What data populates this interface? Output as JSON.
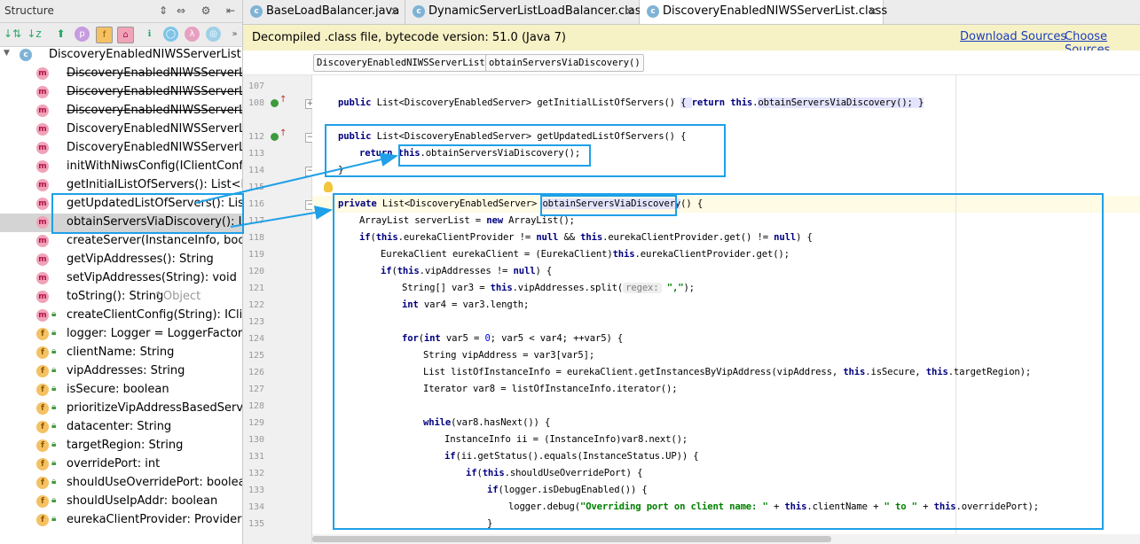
{
  "structure": {
    "title": "Structure",
    "root_label": "DiscoveryEnabledNIWSServerList",
    "items": [
      {
        "label": "DiscoveryEnabledNIWSServerList(",
        "icon": "m",
        "strike": true
      },
      {
        "label": "DiscoveryEnabledNIWSServerList(S",
        "icon": "m",
        "strike": true
      },
      {
        "label": "DiscoveryEnabledNIWSServerList(",
        "icon": "m",
        "strike": true
      },
      {
        "label": "DiscoveryEnabledNIWSServerList(S",
        "icon": "m",
        "strike": false
      },
      {
        "label": "DiscoveryEnabledNIWSServerList(",
        "icon": "m",
        "strike": false
      },
      {
        "label": "initWithNiwsConfig(IClientConfig):",
        "icon": "m",
        "strike": false
      },
      {
        "label": "getInitialListOfServers(): List<Disco",
        "icon": "m",
        "strike": false
      },
      {
        "label": "getUpdatedListOfServers(): List<D",
        "icon": "m",
        "strike": false
      },
      {
        "label": "obtainServersViaDiscovery(): List<",
        "icon": "m",
        "strike": false
      },
      {
        "label": "createServer(InstanceInfo, boolean",
        "icon": "m",
        "strike": false
      },
      {
        "label": "getVipAddresses(): String",
        "icon": "m",
        "strike": false
      },
      {
        "label": "setVipAddresses(String): void",
        "icon": "m",
        "strike": false
      },
      {
        "label": "toString(): String",
        "suffix": "↑Object",
        "icon": "m",
        "strike": false
      },
      {
        "label": "createClientConfig(String): IClientC",
        "icon": "m",
        "strike": false
      },
      {
        "label": "logger: Logger = LoggerFactory.g",
        "icon": "f",
        "strike": false
      },
      {
        "label": "clientName: String",
        "icon": "f",
        "strike": false
      },
      {
        "label": "vipAddresses: String",
        "icon": "f",
        "strike": false
      },
      {
        "label": "isSecure: boolean",
        "icon": "f",
        "strike": false
      },
      {
        "label": "prioritizeVipAddressBasedServers",
        "icon": "f",
        "strike": false
      },
      {
        "label": "datacenter: String",
        "icon": "f",
        "strike": false
      },
      {
        "label": "targetRegion: String",
        "icon": "f",
        "strike": false
      },
      {
        "label": "overridePort: int",
        "icon": "f",
        "strike": false
      },
      {
        "label": "shouldUseOverridePort: boolean",
        "icon": "f",
        "strike": false
      },
      {
        "label": "shouldUseIpAddr: boolean",
        "icon": "f",
        "strike": false
      },
      {
        "label": "eurekaClientProvider: Provider<Eu",
        "icon": "f",
        "strike": false
      }
    ]
  },
  "tabs": [
    {
      "label": "BaseLoadBalancer.java"
    },
    {
      "label": "DynamicServerListLoadBalancer.class"
    },
    {
      "label": "DiscoveryEnabledNIWSServerList.class"
    }
  ],
  "notice": {
    "message": "Decompiled .class file, bytecode version: 51.0 (Java 7)",
    "download": "Download Sources",
    "choose": "Choose Sources..."
  },
  "breadcrumbs": [
    "DiscoveryEnabledNIWSServerList",
    "obtainServersViaDiscovery()"
  ],
  "line_numbers": [
    "107",
    "108",
    "112",
    "113",
    "114",
    "115",
    "116",
    "117",
    "118",
    "119",
    "120",
    "121",
    "122",
    "123",
    "124",
    "125",
    "126",
    "127",
    "128",
    "129",
    "130",
    "131",
    "132",
    "133",
    "134",
    "135"
  ],
  "code": {
    "l108_a": "public",
    "l108_b": " List<DiscoveryEnabledServer> getInitialListOfServers() ",
    "l108_c": "{ ",
    "l108_d": "return",
    "l108_e": "this",
    "l108_f": ".",
    "l108_g": "obtainServersViaDiscovery",
    "l108_h": "(); }",
    "l112_a": "public",
    "l112_b": " List<DiscoveryEnabledServer> getUpdatedListOfServers() {",
    "l113_a": "return",
    "l113_b": "this",
    "l113_c": ".obtainServersViaDiscovery();",
    "l114": "}",
    "l116_a": "private",
    "l116_b": " List<DiscoveryEnabledServer> ",
    "l116_c": "obtainServersViaDiscovery",
    "l116_d": "() {",
    "l117_a": "ArrayList serverList = ",
    "l117_b": "new",
    "l117_c": " ArrayList();",
    "l118_a": "if",
    "l118_b": "(",
    "l118_c": "this",
    "l118_d": ".eurekaClientProvider != ",
    "l118_e": "null",
    "l118_f": " && ",
    "l118_g": "this",
    "l118_h": ".eurekaClientProvider.get() != ",
    "l118_i": "null",
    "l118_j": ") {",
    "l119_a": "EurekaClient eurekaClient = (EurekaClient)",
    "l119_b": "this",
    "l119_c": ".eurekaClientProvider.get();",
    "l120_a": "if",
    "l120_b": "(",
    "l120_c": "this",
    "l120_d": ".vipAddresses != ",
    "l120_e": "null",
    "l120_f": ") {",
    "l121_a": "String[] var3 = ",
    "l121_b": "this",
    "l121_c": ".vipAddresses.split(",
    "l121_hint": "regex:",
    "l121_d": " \",\"",
    "l121_e": ");",
    "l122_a": "int",
    "l122_b": " var4 = var3.length;",
    "l124_a": "for",
    "l124_b": "(",
    "l124_c": "int",
    "l124_d": " var5 = ",
    "l124_e": "0",
    "l124_f": "; var5 < var4; ++var5) {",
    "l125": "String vipAddress = var3[var5];",
    "l126_a": "List listOfInstanceInfo = eurekaClient.getInstancesByVipAddress(vipAddress, ",
    "l126_b": "this",
    "l126_c": ".isSecure, ",
    "l126_d": "this",
    "l126_e": ".targetRegion);",
    "l127": "Iterator var8 = listOfInstanceInfo.iterator();",
    "l129_a": "while",
    "l129_b": "(var8.hasNext()) {",
    "l130": "InstanceInfo ii = (InstanceInfo)var8.next();",
    "l131_a": "if",
    "l131_b": "(ii.getStatus().equals(InstanceStatus.UP)) {",
    "l132_a": "if",
    "l132_b": "(",
    "l132_c": "this",
    "l132_d": ".shouldUseOverridePort) {",
    "l133_a": "if",
    "l133_b": "(logger.isDebugEnabled()) {",
    "l134_a": "logger.debug(",
    "l134_b": "\"Overriding port on client name: \"",
    "l134_c": " + ",
    "l134_d": "this",
    "l134_e": ".clientName + ",
    "l134_f": "\" to \"",
    "l134_g": " + ",
    "l134_h": "this",
    "l134_i": ".overridePort);",
    "l135": "}"
  },
  "colors": {
    "highlight_box": "#1fa0e8",
    "keyword": "#000080",
    "string": "#008000"
  }
}
